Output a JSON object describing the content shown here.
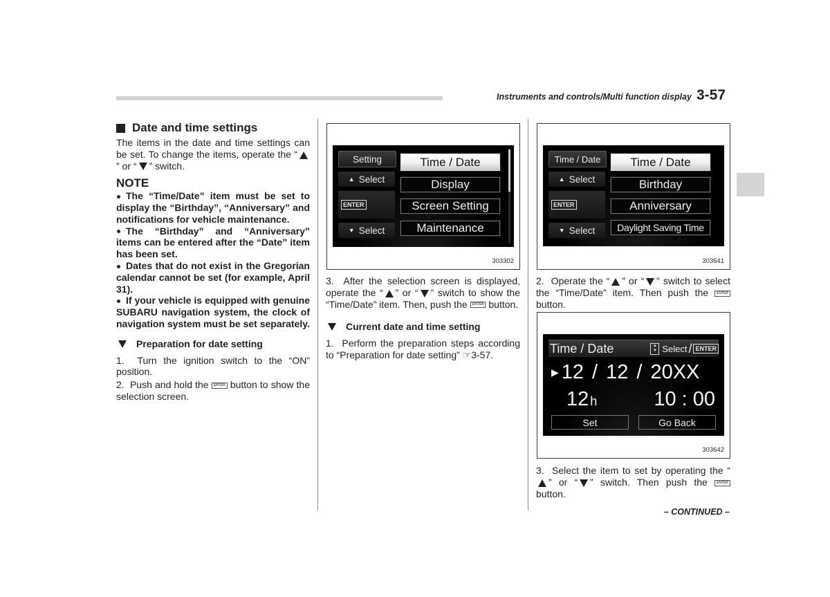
{
  "header": {
    "section_title": "Instruments and controls/Multi function display",
    "page_number": "3-57"
  },
  "column1": {
    "heading": "Date and time settings",
    "intro_part1": "The items in the date and time settings can be set. To change the items, operate the “",
    "intro_part2": "” or “",
    "intro_part3": "” switch.",
    "note_title": "NOTE",
    "notes": [
      "The “Time/Date” item must be set to display the “Birthday”, “Anniversary” and notifications for vehicle maintenance.",
      "The “Birthday” and “Anniversary” items can be entered after the “Date” item has been set.",
      "Dates that do not exist in the Gregorian calendar cannot be set (for example, April 31).",
      "If your vehicle is equipped with genuine SUBARU navigation system, the clock of navigation system must be set separately."
    ],
    "subheading": "Preparation for date setting",
    "step1": "1.  Turn the ignition switch to the “ON” position.",
    "step2_part1": "2.  Push and hold the ",
    "step2_part2": " button to show the selection screen."
  },
  "column2": {
    "figure": {
      "id": "303302",
      "left_buttons": [
        "Setting",
        "Select",
        "ENTER",
        "Select"
      ],
      "menu_items": [
        "Time / Date",
        "Display",
        "Screen Setting",
        "Maintenance"
      ],
      "selected_index": 0,
      "scroll_position": 0.0,
      "scroll_visible_fraction": 0.45
    },
    "step3_part1": "3.  After the selection screen is displayed, operate the “",
    "step3_part2": "” or “",
    "step3_part3": "” switch to show the “Time/Date” item. Then, push the ",
    "step3_part4": " button.",
    "subheading": "Current date and time setting",
    "step1": "1.  Perform the preparation steps according to “Preparation for date setting” ☞3-57."
  },
  "column3": {
    "figure1": {
      "id": "303641",
      "left_buttons": [
        "Time / Date",
        "Select",
        "ENTER",
        "Select"
      ],
      "menu_items": [
        "Time / Date",
        "Birthday",
        "Anniversary",
        "Daylight Saving Time"
      ],
      "selected_index": 0
    },
    "step2_part1": "2.  Operate the “",
    "step2_part2": "” or “",
    "step2_part3": "” switch to select the “Time/Date” item. Then push the ",
    "step2_part4": " button.",
    "figure2": {
      "id": "303642",
      "title": "Time / Date",
      "hint_select": "Select",
      "hint_enter": "ENTER",
      "date_month": "12",
      "date_day": "12",
      "date_year": "20XX",
      "date_sep": "/",
      "hour_format": "12",
      "hour_suffix": "h",
      "time": "10 : 00",
      "btn_set": "Set",
      "btn_back": "Go Back"
    },
    "step3_part1": "3.  Select the item to set by operating the “",
    "step3_part2": "” or “",
    "step3_part3": "” switch. Then push the ",
    "step3_part4": " button.",
    "continued": "– CONTINUED –"
  },
  "icons": {
    "enter_mini_label": "ENTER"
  }
}
